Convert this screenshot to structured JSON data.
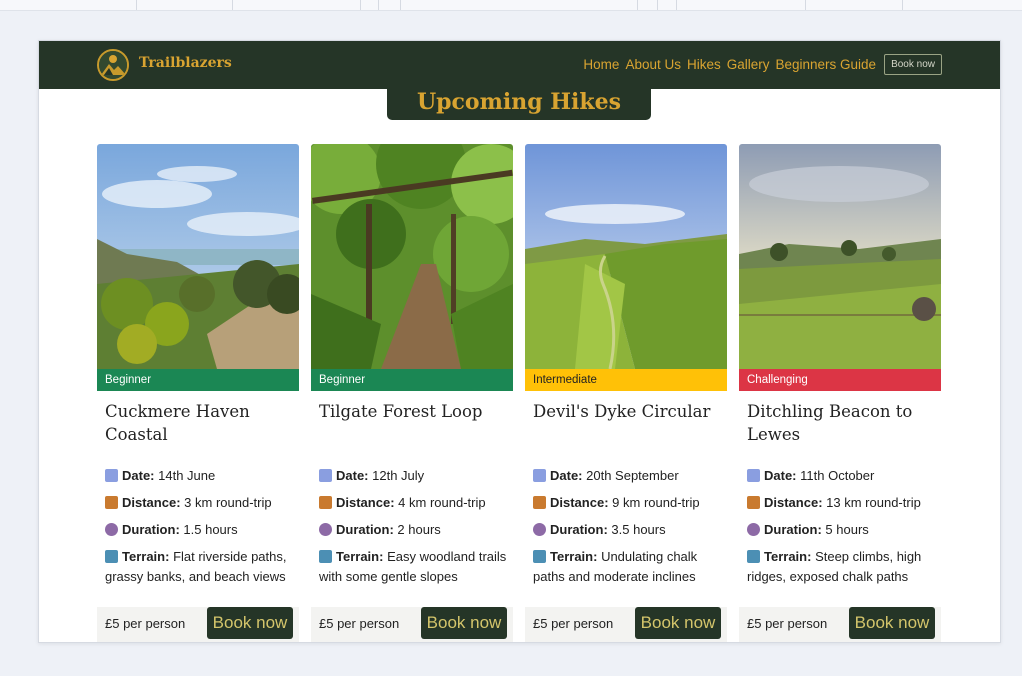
{
  "nav": {
    "brand": "Trailblazers",
    "links": [
      "Home",
      "About Us",
      "Hikes",
      "Gallery",
      "Beginners Guide"
    ],
    "cta": "Book now"
  },
  "section_title": "Upcoming Hikes",
  "field_labels": {
    "date": "Date:",
    "distance": "Distance:",
    "duration": "Duration:",
    "terrain": "Terrain:"
  },
  "colors": {
    "brand_dark": "#253527",
    "brand_gold": "#d9a431",
    "beginner": "#1b8754",
    "intermediate": "#ffc107",
    "challenging": "#dc3545"
  },
  "hikes": [
    {
      "level": "Beginner",
      "title": "Cuckmere Haven Coastal",
      "date": "14th June",
      "distance": "3 km round-trip",
      "duration": "1.5 hours",
      "terrain": "Flat riverside paths, grassy banks, and beach views",
      "price": "£5 per person",
      "button": "Book now",
      "image_icon": "coastal-photo"
    },
    {
      "level": "Beginner",
      "title": "Tilgate Forest Loop",
      "date": "12th July",
      "distance": "4 km round-trip",
      "duration": "2 hours",
      "terrain": "Easy woodland trails with some gentle slopes",
      "price": "£5 per person",
      "button": "Book now",
      "image_icon": "forest-photo"
    },
    {
      "level": "Intermediate",
      "title": "Devil's Dyke Circular",
      "date": "20th September",
      "distance": "9 km round-trip",
      "duration": "3.5 hours",
      "terrain": "Undulating chalk paths and moderate inclines",
      "price": "£5 per person",
      "button": "Book now",
      "image_icon": "valley-photo"
    },
    {
      "level": "Challenging",
      "title": "Ditchling Beacon to Lewes",
      "date": "11th October",
      "distance": "13 km round-trip",
      "duration": "5 hours",
      "terrain": "Steep climbs, high ridges, exposed chalk paths",
      "price": "£5 per person",
      "button": "Book now",
      "image_icon": "hills-photo"
    }
  ]
}
